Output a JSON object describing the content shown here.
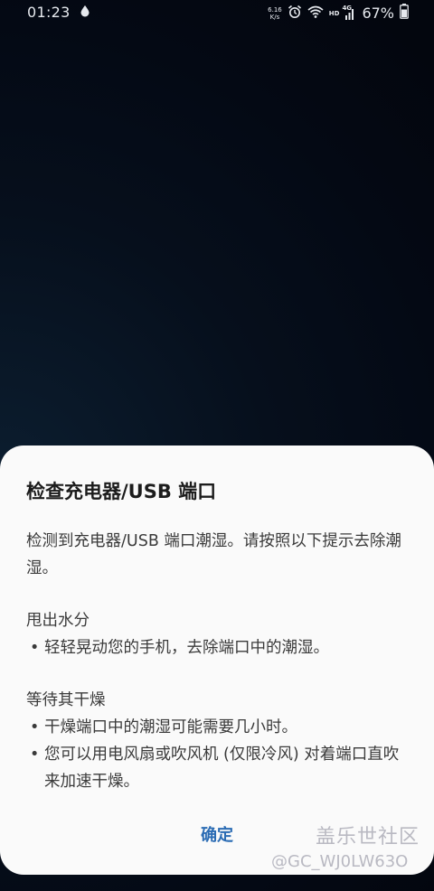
{
  "status_bar": {
    "time": "01:23",
    "net_speed_value": "6.16",
    "net_speed_unit": "K/s",
    "hd_label": "HD",
    "network_type": "4G",
    "battery": "67%",
    "icons": [
      "water-drop-icon",
      "alarm-icon",
      "wifi-icon",
      "signal-icon",
      "battery-icon"
    ]
  },
  "dialog": {
    "title": "检查充电器/USB 端口",
    "intro": "检测到充电器/USB 端口潮湿。请按照以下提示去除潮湿。",
    "section1_title": "甩出水分",
    "section1_bullets": [
      "轻轻晃动您的手机，去除端口中的潮湿。"
    ],
    "section2_title": "等待其干燥",
    "section2_bullets": [
      "干燥端口中的潮湿可能需要几小时。",
      "您可以用电风扇或吹风机 (仅限冷风) 对着端口直吹来加速干燥。"
    ],
    "confirm_label": "确定",
    "bullet_char": "•"
  },
  "watermark": {
    "brand": "盖乐世社区",
    "user": "@GC_WJ0LW63O"
  },
  "colors": {
    "dialog_background": "#fafafa",
    "accent": "#2b6cb4",
    "title_text": "#1c1c1c",
    "body_text": "#3a3a3a"
  }
}
